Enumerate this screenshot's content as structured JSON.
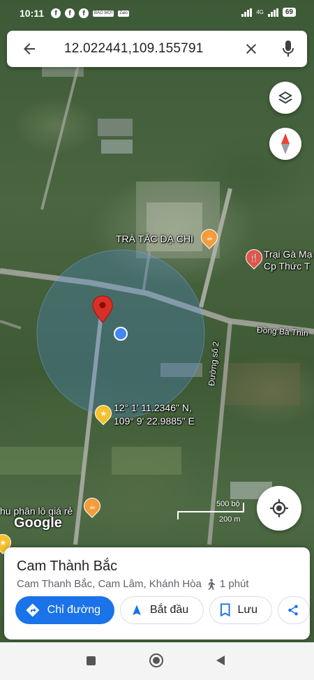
{
  "status_bar": {
    "time": "10:11",
    "app_icons": [
      "facebook-icon",
      "facebook-icon",
      "facebook-icon",
      "bao-moi-icon",
      "zalo-icon"
    ],
    "bao_moi_label": "BÁO MỚI",
    "zalo_label": "Zalo",
    "network": "4G",
    "battery": "69"
  },
  "search": {
    "query": "12.022441,109.155791"
  },
  "map_labels": {
    "poi_tea": "TRÀ TẮC DẠ CHI",
    "poi_chicken_line1": "Trại Gà Mạ",
    "poi_chicken_line2": "Cp Thức T",
    "road_east": "Đồng Bà Thìn",
    "road_duong_so_2": "Đường số 2",
    "coord_line1": "12° 1' 11.2346\" N,",
    "coord_line2": "109° 9' 22.9885\" E",
    "poi_land": "hu phân lô giá rẻ"
  },
  "map": {
    "google_logo": "Google",
    "scale_imperial": "500 bộ",
    "scale_metric": "200 m"
  },
  "place": {
    "title": "Cam Thành Bắc",
    "subtitle": "Cam Thanh Bắc, Cam Lâm, Khánh Hòa",
    "walk_time": "1 phút"
  },
  "actions": {
    "directions": "Chỉ đường",
    "start": "Bắt đầu",
    "save": "Lưu"
  },
  "colors": {
    "accent": "#1a73e8",
    "pin_red": "#d93025",
    "poi_orange": "#f29c3c",
    "poi_red": "#e0564a",
    "marker_yellow": "#f5c12e"
  }
}
